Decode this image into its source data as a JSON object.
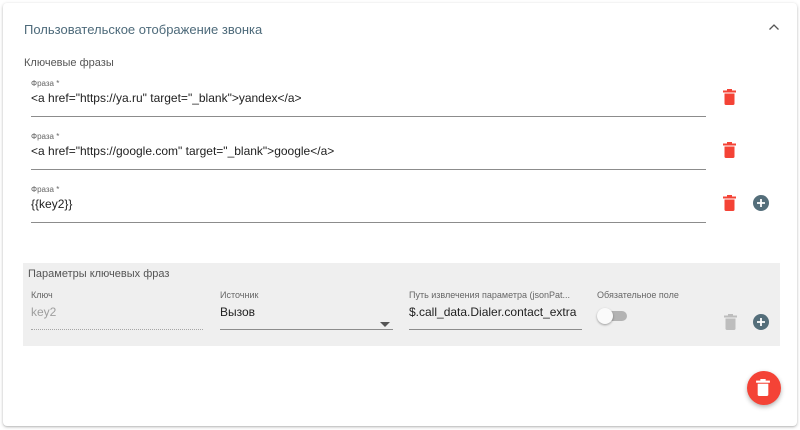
{
  "panel": {
    "title": "Пользовательское отображение звонка",
    "collapse_icon": "chevron-up-icon"
  },
  "key_phrases": {
    "section_label": "Ключевые фразы",
    "items": [
      {
        "label": "Фраза *",
        "value": "<a href=\"https://ya.ru\" target=\"_blank\">yandex</a>"
      },
      {
        "label": "Фраза *",
        "value": "<a href=\"https://google.com\" target=\"_blank\">google</a>"
      },
      {
        "label": "Фраза *",
        "value": "{{key2}}"
      }
    ],
    "delete_icon": "delete-icon",
    "add_icon": "add-circle-icon"
  },
  "params": {
    "title": "Параметры ключевых фраз",
    "key": {
      "label": "Ключ",
      "value": "key2"
    },
    "source": {
      "label": "Источник",
      "value": "Вызов"
    },
    "path": {
      "label": "Путь извлечения параметра (jsonPat...",
      "value": "$.call_data.Dialer.contact_extra"
    },
    "required": {
      "label": "Обязательное поле",
      "checked": false
    }
  },
  "colors": {
    "delete_red": "#f44336",
    "add_blue": "#546e7a",
    "disabled_grey": "#bdbdbd"
  }
}
